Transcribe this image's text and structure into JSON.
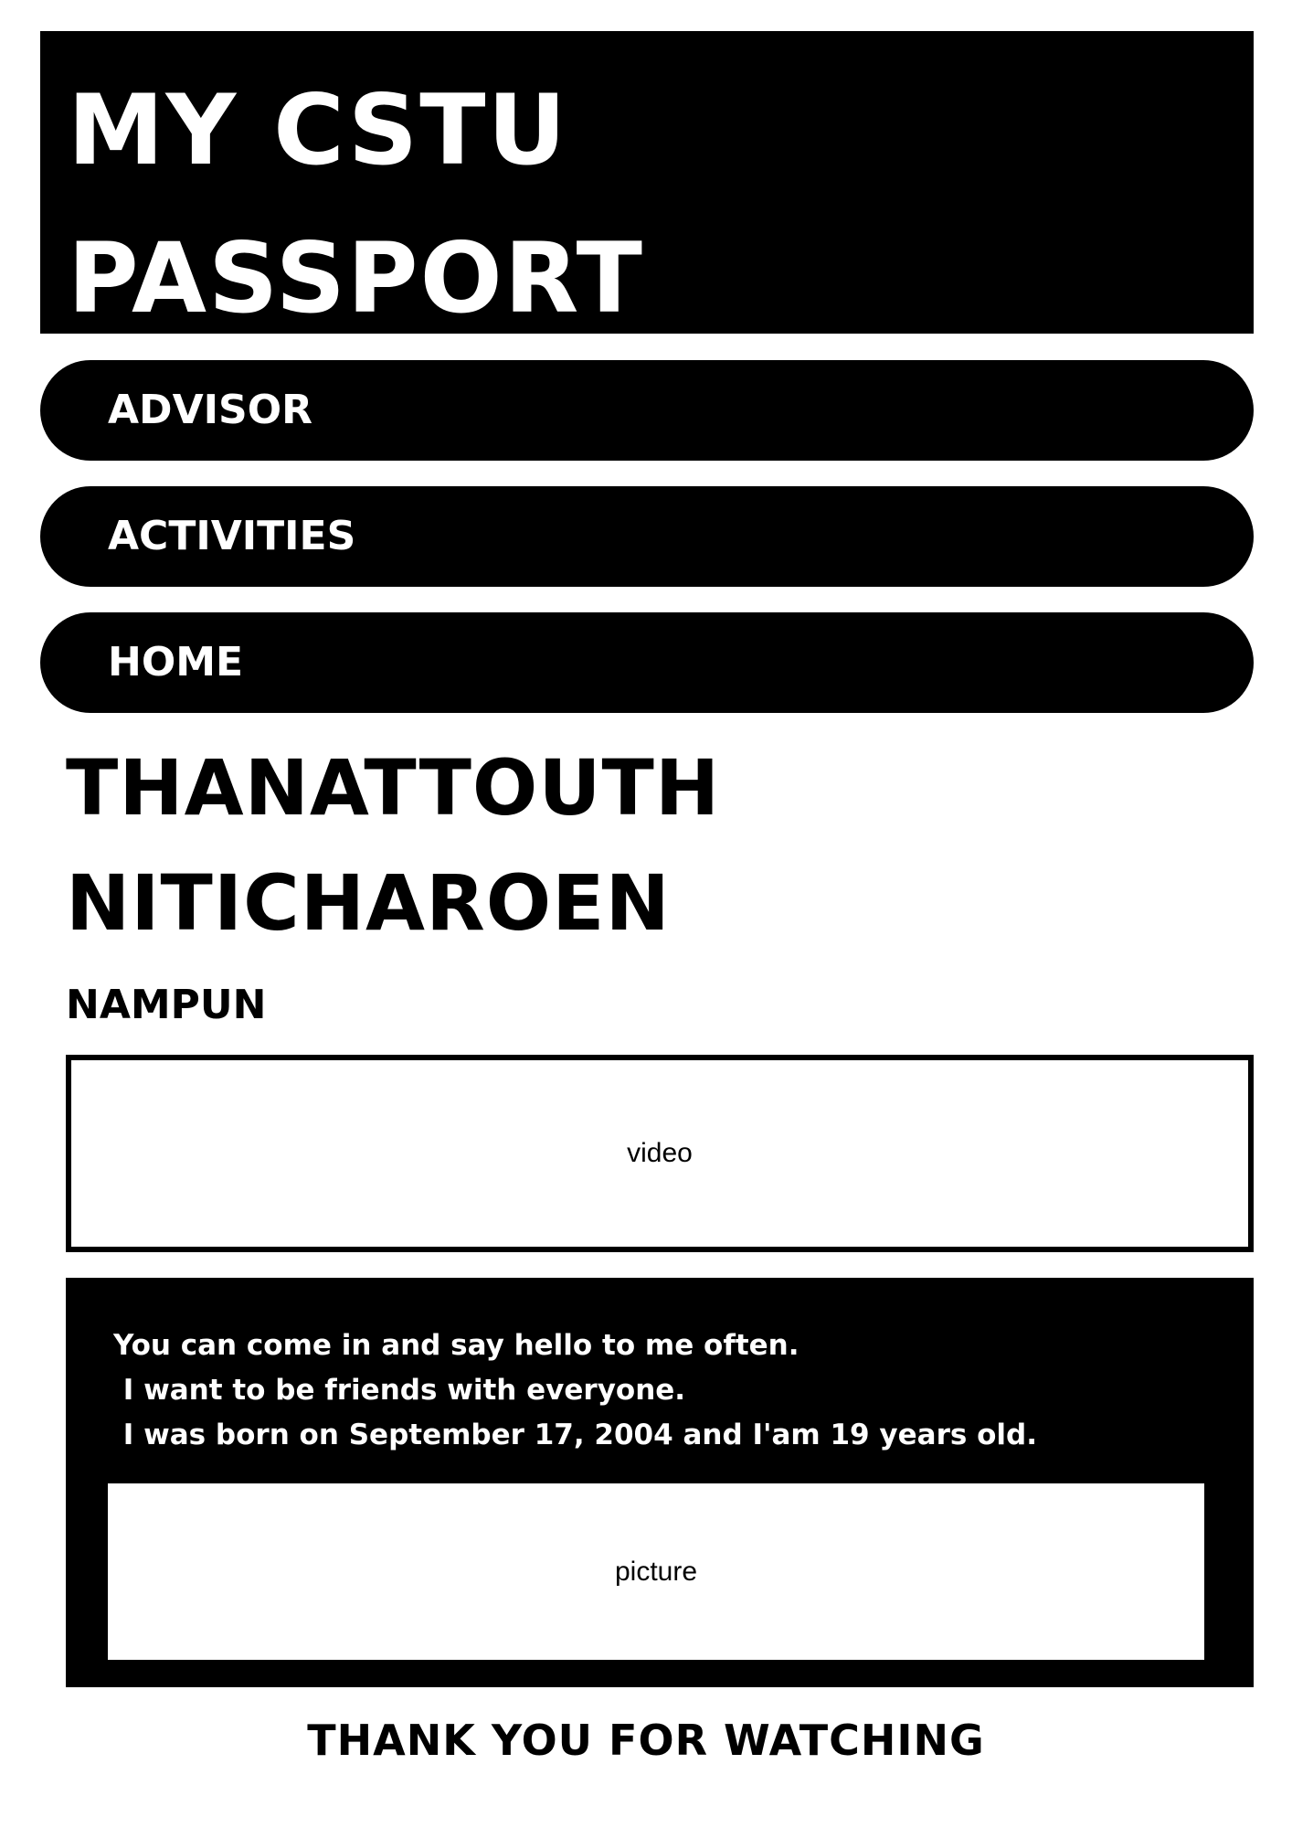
{
  "header": {
    "title": "MY CSTU\nPASSPORT"
  },
  "nav": {
    "items": [
      {
        "label": "ADVISOR"
      },
      {
        "label": "ACTIVITIES"
      },
      {
        "label": "HOME"
      }
    ]
  },
  "profile": {
    "first_name": "THANATTOUTH",
    "last_name": "NITICHAROEN",
    "nickname": "NAMPUN"
  },
  "media": {
    "video_label": "video",
    "picture_label": "picture"
  },
  "bio": {
    "lines": [
      "You can come in and say hello to me often.",
      " I want to be friends with everyone.",
      " I was born on September 17, 2004 and I'am 19 years old."
    ]
  },
  "footer": {
    "text": "THANK YOU FOR WATCHING"
  },
  "colors": {
    "primary": "#000000",
    "background": "#ffffff",
    "text_on_primary": "#ffffff"
  }
}
